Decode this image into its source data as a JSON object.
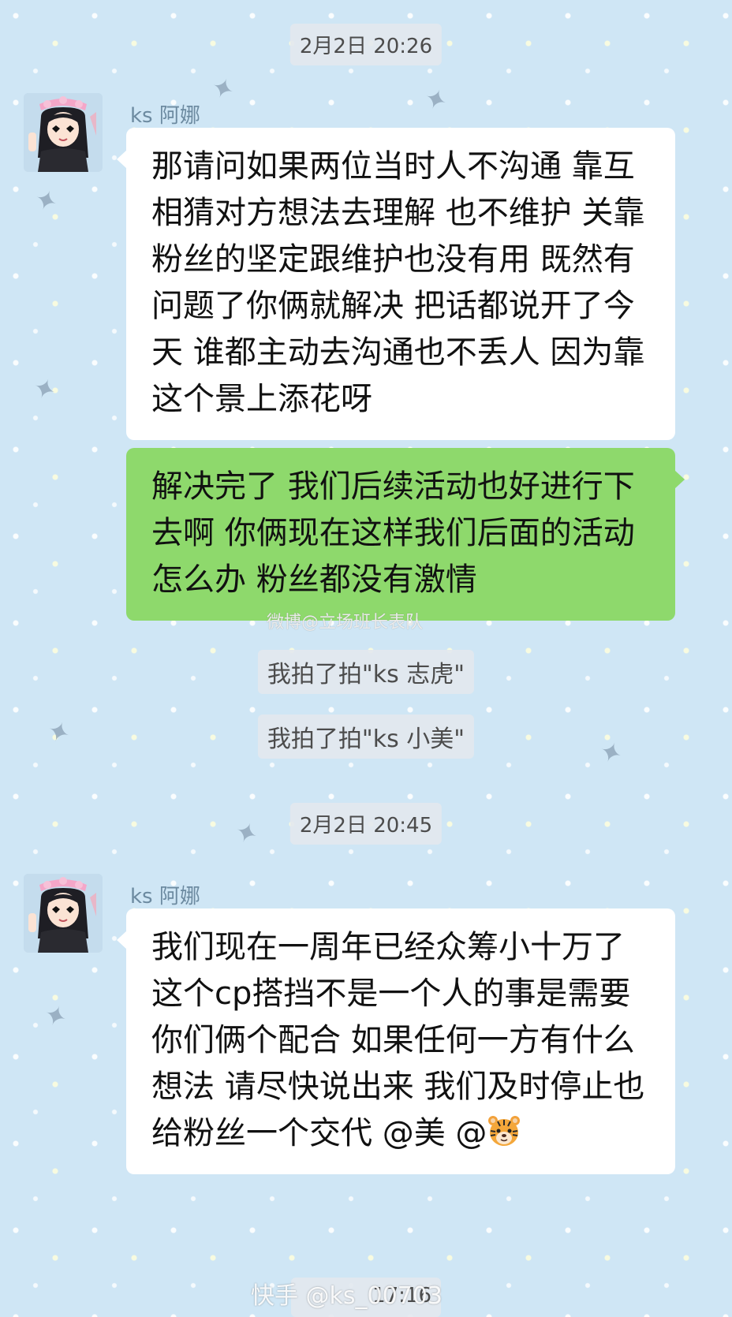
{
  "chat": {
    "timestamp_1": "2月2日 20:26",
    "timestamp_2": "2月2日 20:45",
    "timestamp_3_partial": "17:16",
    "messages": [
      {
        "sender": "ks 阿娜",
        "direction": "incoming",
        "text": "那请问如果两位当时人不沟通 靠互相猜对方想法去理解 也不维护 关靠粉丝的坚定跟维护也没有用 既然有问题了你俩就解决 把话都说开了今天  谁都主动去沟通也不丢人 因为靠这个景上添花呀"
      },
      {
        "sender": "",
        "direction": "outgoing",
        "text": "解决完了 我们后续活动也好进行下去啊 你俩现在这样我们后面的活动怎么办 粉丝都没有激情"
      },
      {
        "sender": "ks 阿娜",
        "direction": "incoming",
        "text": "我们现在一周年已经众筹小十万了 这个cp搭挡不是一个人的事是需要你们俩个配合 如果任何一方有什么想法 请尽快说出来 我们及时停止也给粉丝一个交代 @美 @"
      }
    ],
    "system_messages": [
      "我拍了拍\"ks 志虎\"",
      "我拍了拍\"ks 小美\""
    ]
  },
  "watermarks": {
    "weibo": "微博@立场班长表队",
    "kuaishou": "快手 @ks_00703"
  },
  "icons": {
    "avatar": "girl-avatar-icon",
    "emoji": "tiger-face-icon",
    "background_decoration": "star-icon"
  },
  "colors": {
    "background": "#cfe6f5",
    "incoming_bubble": "#ffffff",
    "outgoing_bubble": "#8ed96c",
    "sender_name": "#6c8aa0"
  }
}
